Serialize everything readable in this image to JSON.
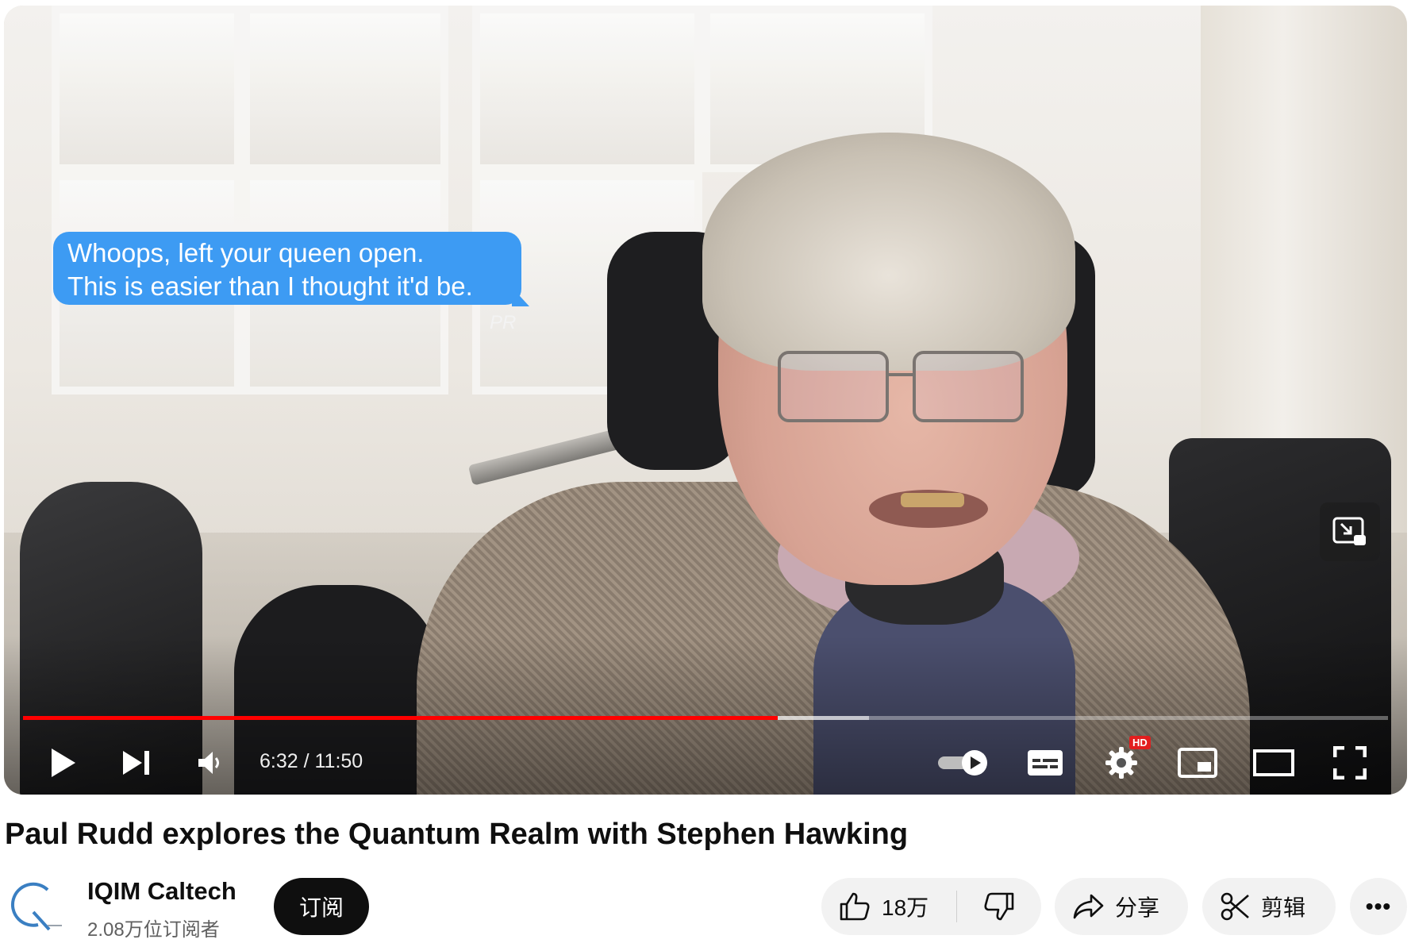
{
  "player": {
    "caption_lines": [
      "Whoops, left your queen open.",
      "This is easier than I thought it'd be."
    ],
    "caption_signature": "PR",
    "time_display": "6:32 / 11:50",
    "progress_fraction": 0.553,
    "buffered_fraction": 0.62,
    "hd_badge": "HD",
    "icons": [
      "play-icon",
      "next-icon",
      "volume-icon",
      "autoplay-toggle-icon",
      "subtitles-icon",
      "settings-icon",
      "miniplayer-icon",
      "theater-icon",
      "fullscreen-icon",
      "exit-overlay-icon"
    ]
  },
  "video": {
    "title": "Paul Rudd explores the Quantum Realm with Stephen Hawking"
  },
  "channel": {
    "name": "IQIM Caltech",
    "subscribers": "2.08万位订阅者",
    "subscribe_label": "订阅"
  },
  "actions": {
    "like_count": "18万",
    "share_label": "分享",
    "clip_label": "剪辑",
    "more_label": "•••"
  },
  "colors": {
    "progress": "#ff0000",
    "bubble": "#3d9bf3",
    "button_dark": "#0f0f0f",
    "pill_bg": "#f2f2f2"
  }
}
